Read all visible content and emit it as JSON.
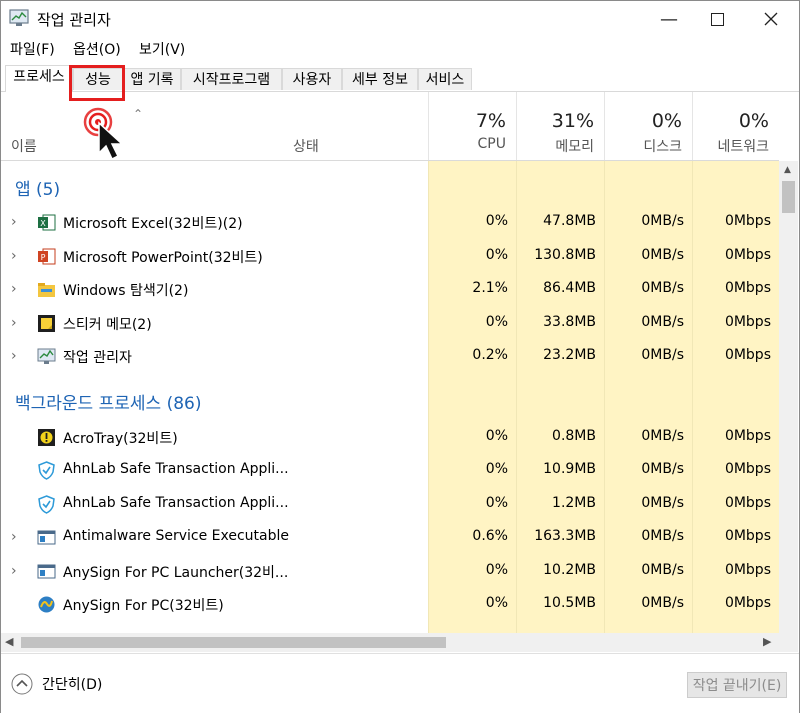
{
  "window": {
    "title": "작업 관리자"
  },
  "menu": {
    "file": "파일(F)",
    "options": "옵션(O)",
    "view": "보기(V)"
  },
  "tabs": [
    "프로세스",
    "성능",
    "앱 기록",
    "시작프로그램",
    "사용자",
    "세부 정보",
    "서비스"
  ],
  "columns": {
    "name": "이름",
    "status": "상태",
    "cpu": {
      "pct": "7%",
      "label": "CPU"
    },
    "memory": {
      "pct": "31%",
      "label": "메모리"
    },
    "disk": {
      "pct": "0%",
      "label": "디스크"
    },
    "network": {
      "pct": "0%",
      "label": "네트워크"
    }
  },
  "groups": {
    "apps": "앱 (5)",
    "background": "백그라운드 프로세스 (86)"
  },
  "apps": [
    {
      "name": "Microsoft Excel(32비트)(2)",
      "cpu": "0%",
      "mem": "47.8MB",
      "disk": "0MB/s",
      "net": "0Mbps",
      "icon": "excel-icon"
    },
    {
      "name": "Microsoft PowerPoint(32비트)",
      "cpu": "0%",
      "mem": "130.8MB",
      "disk": "0MB/s",
      "net": "0Mbps",
      "icon": "powerpoint-icon"
    },
    {
      "name": "Windows 탐색기(2)",
      "cpu": "2.1%",
      "mem": "86.4MB",
      "disk": "0MB/s",
      "net": "0Mbps",
      "icon": "explorer-icon"
    },
    {
      "name": "스티커 메모(2)",
      "cpu": "0%",
      "mem": "33.8MB",
      "disk": "0MB/s",
      "net": "0Mbps",
      "icon": "sticky-notes-icon"
    },
    {
      "name": "작업 관리자",
      "cpu": "0.2%",
      "mem": "23.2MB",
      "disk": "0MB/s",
      "net": "0Mbps",
      "icon": "task-manager-icon"
    }
  ],
  "background": [
    {
      "name": "AcroTray(32비트)",
      "cpu": "0%",
      "mem": "0.8MB",
      "disk": "0MB/s",
      "net": "0Mbps",
      "icon": "acrotray-icon"
    },
    {
      "name": "AhnLab Safe Transaction Appli...",
      "cpu": "0%",
      "mem": "10.9MB",
      "disk": "0MB/s",
      "net": "0Mbps",
      "icon": "ahnlab-shield-icon"
    },
    {
      "name": "AhnLab Safe Transaction Appli...",
      "cpu": "0%",
      "mem": "1.2MB",
      "disk": "0MB/s",
      "net": "0Mbps",
      "icon": "ahnlab-shield-icon"
    },
    {
      "name": "Antimalware Service Executable",
      "cpu": "0.6%",
      "mem": "163.3MB",
      "disk": "0MB/s",
      "net": "0Mbps",
      "icon": "service-window-icon"
    },
    {
      "name": "AnySign For PC Launcher(32비...",
      "cpu": "0%",
      "mem": "10.2MB",
      "disk": "0MB/s",
      "net": "0Mbps",
      "icon": "service-window-icon"
    },
    {
      "name": "AnySign For PC(32비트)",
      "cpu": "0%",
      "mem": "10.5MB",
      "disk": "0MB/s",
      "net": "0Mbps",
      "icon": "anysign-icon"
    }
  ],
  "footer": {
    "fewer_details": "간단히(D)",
    "end_task": "작업 끝내기(E)"
  }
}
